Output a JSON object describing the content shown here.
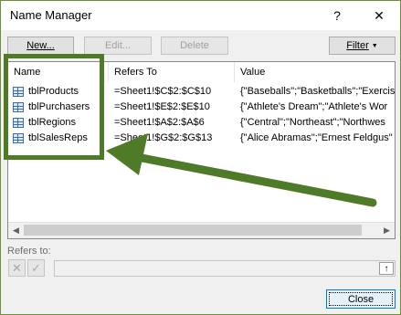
{
  "window": {
    "title": "Name Manager",
    "help_label": "?",
    "close_label": "✕"
  },
  "toolbar": {
    "new_label": "New...",
    "edit_label": "Edit...",
    "delete_label": "Delete",
    "filter_label": "Filter"
  },
  "list": {
    "columns": {
      "name": "Name",
      "refers_to": "Refers To",
      "value": "Value"
    },
    "rows": [
      {
        "name": "tblProducts",
        "refers_to": "=Sheet1!$C$2:$C$10",
        "value": "{\"Baseballs\";\"Basketballs\";\"Exercis"
      },
      {
        "name": "tblPurchasers",
        "refers_to": "=Sheet1!$E$2:$E$10",
        "value": "{\"Athlete's Dream\";\"Athlete's Wor"
      },
      {
        "name": "tblRegions",
        "refers_to": "=Sheet1!$A$2:$A$6",
        "value": "{\"Central\";\"Northeast\";\"Northwes"
      },
      {
        "name": "tblSalesReps",
        "refers_to": "=Sheet1!$G$2:$G$13",
        "value": "{\"Alice Abramas\";\"Ernest Feldgus\""
      }
    ]
  },
  "refers_to": {
    "label": "Refers to:",
    "value": ""
  },
  "footer": {
    "close_label": "Close"
  },
  "annotation": {
    "color": "#4f7a28"
  }
}
